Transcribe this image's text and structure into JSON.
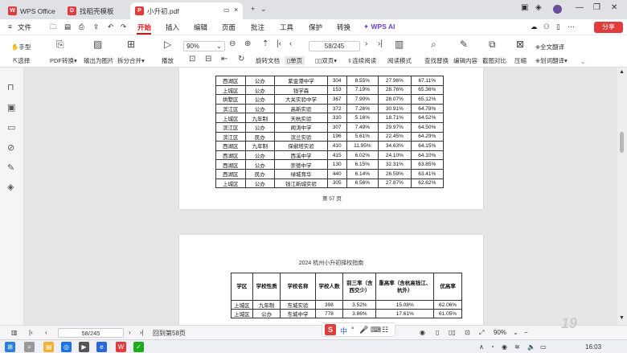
{
  "tabs": [
    {
      "label": "WPS Office",
      "icon": "W",
      "color": "#e23b3b"
    },
    {
      "label": "找稻壳模板",
      "icon": "D",
      "color": "#e23b3b"
    },
    {
      "label": "小升初.pdf",
      "icon": "P",
      "color": "#e23b3b"
    }
  ],
  "menu": {
    "file": "文件",
    "items": [
      "开始",
      "插入",
      "编辑",
      "页面",
      "批注",
      "工具",
      "保护",
      "转换"
    ],
    "ai": "WPS AI",
    "share": "分享"
  },
  "toolbar": {
    "hand": "手型",
    "select": "选择",
    "pdf_convert": "PDF转换",
    "export_image": "输出为图片",
    "split_merge": "拆分合并",
    "play": "播放",
    "zoom": "90%",
    "rotate": "旋转文档",
    "single": "单页",
    "double": "双页",
    "continuous": "连续阅读",
    "read_mode": "阅读模式",
    "page_input": "58/245",
    "find_replace": "查找替换",
    "edit_content": "编辑内容",
    "screenshot_compare": "截图对比",
    "compress": "压缩",
    "full_translate": "全文翻译",
    "word_translate": "划词翻译"
  },
  "page57": {
    "rows": [
      [
        "西湖区",
        "公办",
        "紫金港中学",
        "304",
        "8.55%",
        "27.96%",
        "67.11%"
      ],
      [
        "上城区",
        "公办",
        "钱学森",
        "153",
        "7.19%",
        "28.76%",
        "65.36%"
      ],
      [
        "拱墅区",
        "公办",
        "大关实验中学",
        "367",
        "7.90%",
        "28.07%",
        "65.12%"
      ],
      [
        "滨江区",
        "公办",
        "高新实验",
        "372",
        "7.26%",
        "30.91%",
        "64.78%"
      ],
      [
        "上城区",
        "九年制",
        "天杭实验",
        "310",
        "5.16%",
        "18.71%",
        "64.52%"
      ],
      [
        "滨江区",
        "公办",
        "闻涛中学",
        "307",
        "7.49%",
        "29.97%",
        "64.50%"
      ],
      [
        "滨江区",
        "民办",
        "滨兰实验",
        "196",
        "5.61%",
        "22.45%",
        "64.29%"
      ],
      [
        "西湖区",
        "九年制",
        "保俶塔实验",
        "410",
        "11.95%",
        "34.63%",
        "64.15%"
      ],
      [
        "西湖区",
        "公办",
        "西溪中学",
        "415",
        "6.02%",
        "24.10%",
        "64.10%"
      ],
      [
        "西湖区",
        "公办",
        "崇德中学",
        "130",
        "6.15%",
        "32.31%",
        "63.85%"
      ],
      [
        "西湖区",
        "民办",
        "绿城育华",
        "440",
        "6.14%",
        "26.59%",
        "63.41%"
      ],
      [
        "上城区",
        "公办",
        "钱江新城实验",
        "305",
        "6.56%",
        "27.87%",
        "62.62%"
      ]
    ],
    "page_label": "第 57 页"
  },
  "page58": {
    "title": "2024 杭州小升初择校指南",
    "headers": [
      "学区",
      "学校性质",
      "学校名称",
      "学校人数",
      "前三率（含西交少）",
      "重高率（含杭高钱江、杭外）",
      "优高率"
    ],
    "rows": [
      [
        "上城区",
        "九年制",
        "东城实验",
        "398",
        "3.52%",
        "15.08%",
        "62.06%"
      ],
      [
        "上城区",
        "公办",
        "东城中学",
        "778",
        "3.86%",
        "17.61%",
        "61.05%"
      ]
    ]
  },
  "statusbar": {
    "page_input": "58/245",
    "back_to": "回到第58页",
    "zoom": "90%"
  },
  "taskbar": {
    "time": "16:03",
    "ime_lang": "中"
  }
}
